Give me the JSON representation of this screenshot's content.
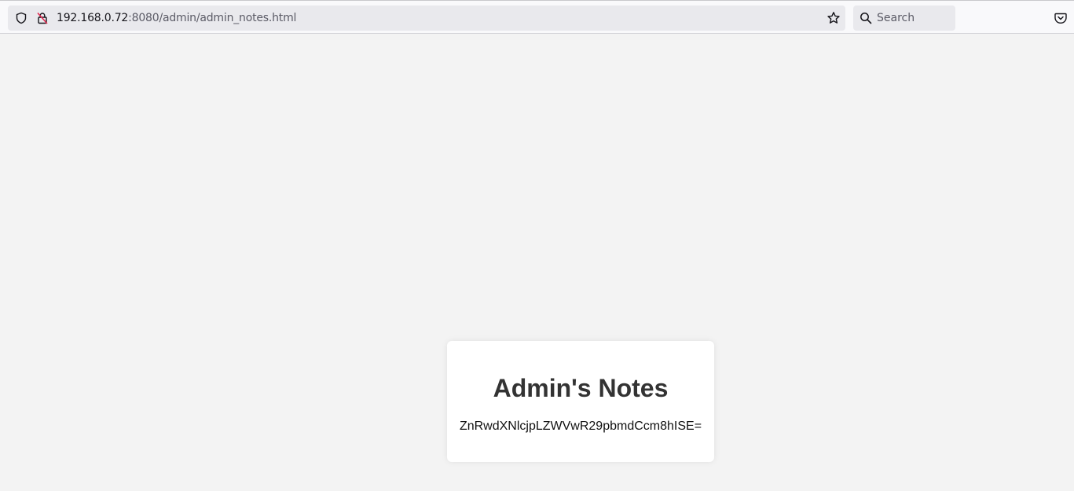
{
  "browser": {
    "url_host": "192.168.0.72",
    "url_rest": ":8080/admin/admin_notes.html",
    "search_placeholder": "Search",
    "icons": [
      "shield-icon",
      "insecure-lock-icon",
      "bookmark-star-icon",
      "search-icon",
      "pocket-icon"
    ]
  },
  "page": {
    "title": "Admin's Notes",
    "note": "ZnRwdXNlcjpLZWVwR29pbmdCcm8hISE="
  }
}
